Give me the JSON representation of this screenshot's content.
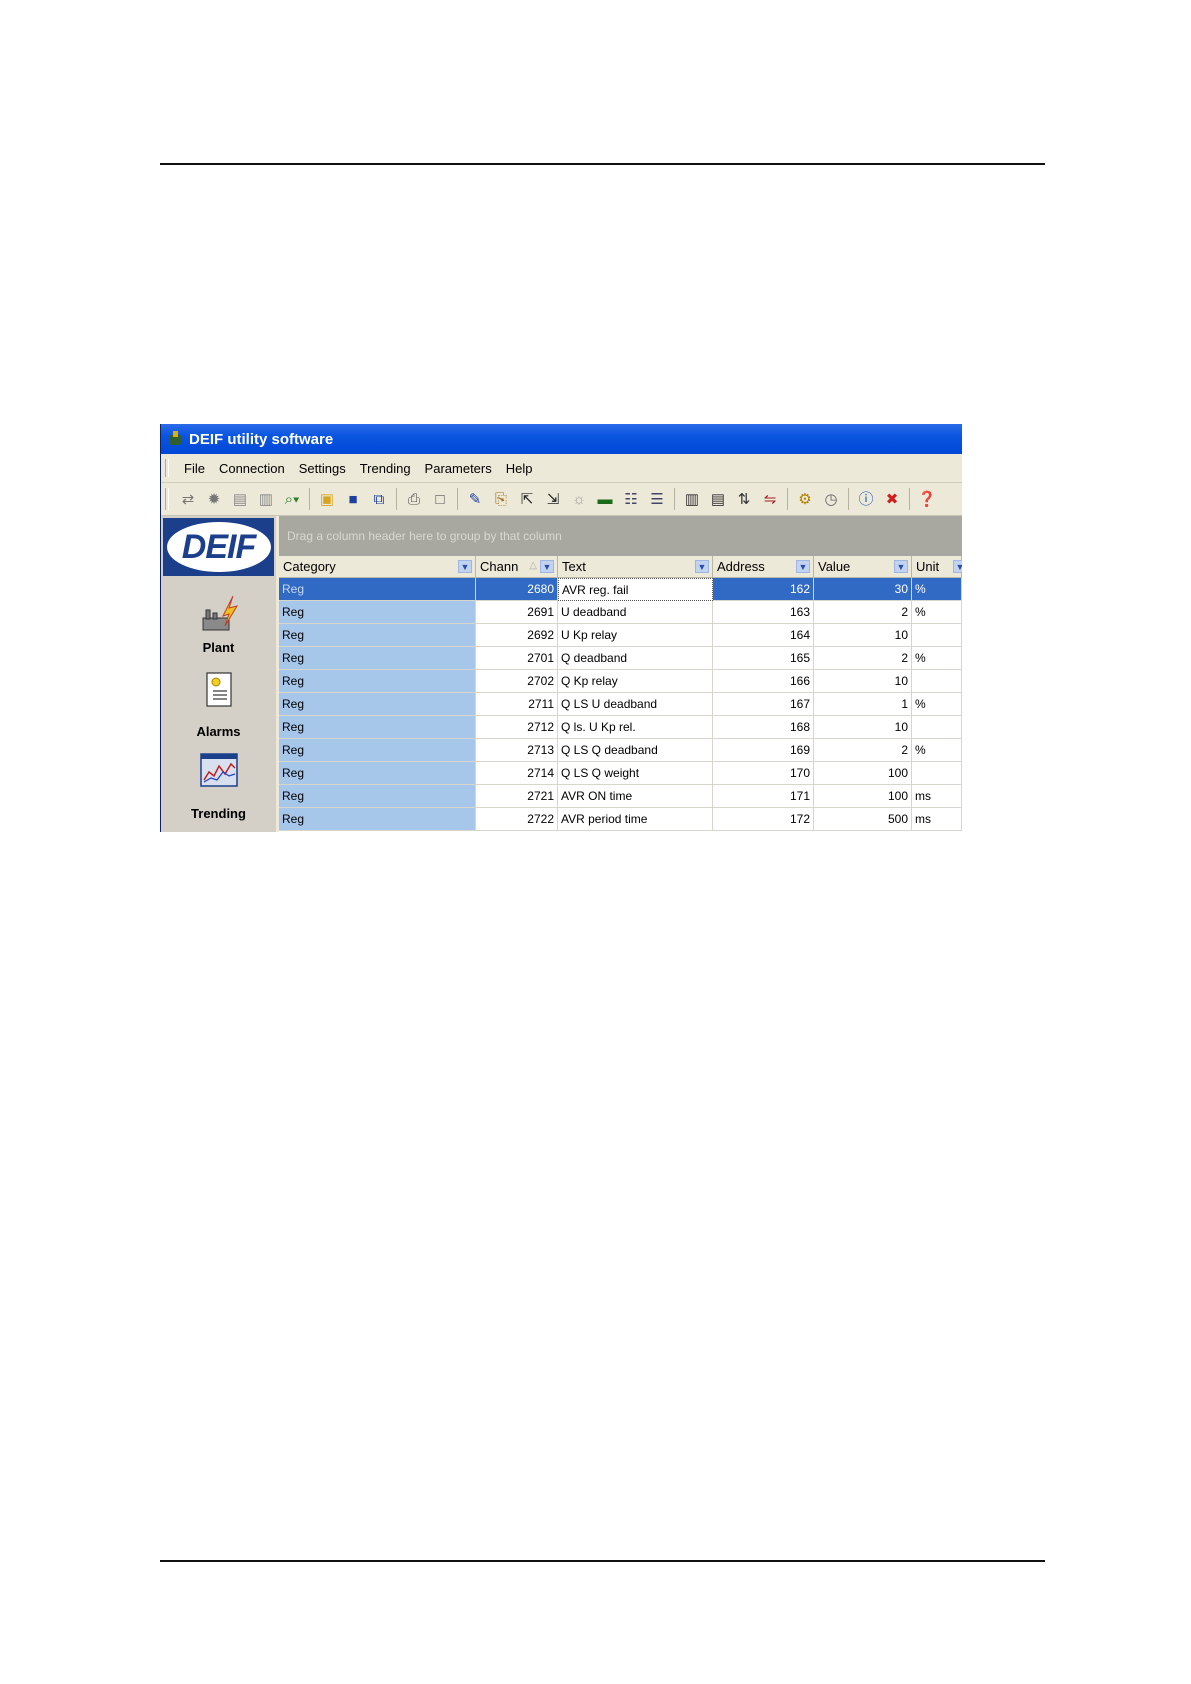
{
  "window": {
    "title": "DEIF utility software"
  },
  "menu": [
    "File",
    "Connection",
    "Settings",
    "Trending",
    "Parameters",
    "Help"
  ],
  "toolbar_icons": [
    "connect-icon",
    "disconnect-icon",
    "read-icon",
    "write-icon",
    "search-icon",
    "open-folder-icon",
    "save-icon",
    "save-all-icon",
    "print-icon",
    "print-preview-icon",
    "pen-icon",
    "paste-icon",
    "arrow-out-icon",
    "arrow-in-icon",
    "refresh-icon",
    "chip-icon",
    "chart-icon",
    "chart-compare-icon",
    "list-icon",
    "list2-icon",
    "sort-icon",
    "swap-icon",
    "settings-icon",
    "timer-icon",
    "info-icon",
    "stop-icon",
    "help-icon"
  ],
  "logo": "DEIF",
  "nav": {
    "plant": "Plant",
    "alarms": "Alarms",
    "trending": "Trending"
  },
  "grid": {
    "group_hint": "Drag a column header here to group by that column",
    "columns": {
      "category": "Category",
      "channel": "Chann",
      "text": "Text",
      "address": "Address",
      "value": "Value",
      "unit": "Unit"
    },
    "rows": [
      {
        "category": "Reg",
        "channel": "2680",
        "text": "AVR reg. fail",
        "address": "162",
        "value": "30",
        "unit": "%"
      },
      {
        "category": "Reg",
        "channel": "2691",
        "text": "U deadband",
        "address": "163",
        "value": "2",
        "unit": "%"
      },
      {
        "category": "Reg",
        "channel": "2692",
        "text": "U Kp relay",
        "address": "164",
        "value": "10",
        "unit": ""
      },
      {
        "category": "Reg",
        "channel": "2701",
        "text": "Q deadband",
        "address": "165",
        "value": "2",
        "unit": "%"
      },
      {
        "category": "Reg",
        "channel": "2702",
        "text": "Q Kp relay",
        "address": "166",
        "value": "10",
        "unit": ""
      },
      {
        "category": "Reg",
        "channel": "2711",
        "text": "Q LS U deadband",
        "address": "167",
        "value": "1",
        "unit": "%"
      },
      {
        "category": "Reg",
        "channel": "2712",
        "text": "Q ls. U Kp rel.",
        "address": "168",
        "value": "10",
        "unit": ""
      },
      {
        "category": "Reg",
        "channel": "2713",
        "text": "Q LS Q deadband",
        "address": "169",
        "value": "2",
        "unit": "%"
      },
      {
        "category": "Reg",
        "channel": "2714",
        "text": "Q LS Q weight",
        "address": "170",
        "value": "100",
        "unit": ""
      },
      {
        "category": "Reg",
        "channel": "2721",
        "text": "AVR ON time",
        "address": "171",
        "value": "100",
        "unit": "ms"
      },
      {
        "category": "Reg",
        "channel": "2722",
        "text": "AVR period time",
        "address": "172",
        "value": "500",
        "unit": "ms"
      }
    ]
  }
}
